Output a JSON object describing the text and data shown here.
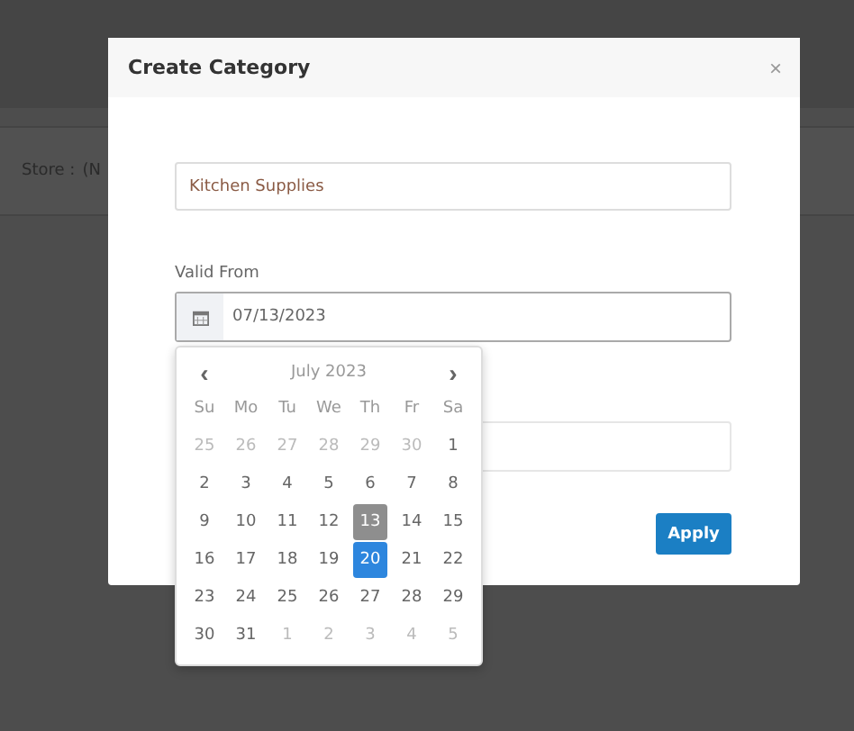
{
  "page": {
    "store_label": "Store :",
    "store_value": "(N"
  },
  "dialog": {
    "title": "Create Category",
    "close": "×",
    "name_value": "Kitchen Supplies",
    "valid_from_label": "Valid From",
    "valid_from_value": "07/13/2023",
    "apply": "Apply"
  },
  "datepicker": {
    "month": "July 2023",
    "prev": "‹",
    "next": "›",
    "weekdays": [
      "Su",
      "Mo",
      "Tu",
      "We",
      "Th",
      "Fr",
      "Sa"
    ],
    "weeks": [
      [
        {
          "day": "25",
          "other_month": true,
          "selected": false,
          "today": false
        },
        {
          "day": "26",
          "other_month": true,
          "selected": false,
          "today": false
        },
        {
          "day": "27",
          "other_month": true,
          "selected": false,
          "today": false
        },
        {
          "day": "28",
          "other_month": true,
          "selected": false,
          "today": false
        },
        {
          "day": "29",
          "other_month": true,
          "selected": false,
          "today": false
        },
        {
          "day": "30",
          "other_month": true,
          "selected": false,
          "today": false
        },
        {
          "day": "1",
          "other_month": false,
          "selected": false,
          "today": false
        }
      ],
      [
        {
          "day": "2",
          "other_month": false,
          "selected": false,
          "today": false
        },
        {
          "day": "3",
          "other_month": false,
          "selected": false,
          "today": false
        },
        {
          "day": "4",
          "other_month": false,
          "selected": false,
          "today": false
        },
        {
          "day": "5",
          "other_month": false,
          "selected": false,
          "today": false
        },
        {
          "day": "6",
          "other_month": false,
          "selected": false,
          "today": false
        },
        {
          "day": "7",
          "other_month": false,
          "selected": false,
          "today": false
        },
        {
          "day": "8",
          "other_month": false,
          "selected": false,
          "today": false
        }
      ],
      [
        {
          "day": "9",
          "other_month": false,
          "selected": false,
          "today": false
        },
        {
          "day": "10",
          "other_month": false,
          "selected": false,
          "today": false
        },
        {
          "day": "11",
          "other_month": false,
          "selected": false,
          "today": false
        },
        {
          "day": "12",
          "other_month": false,
          "selected": false,
          "today": false
        },
        {
          "day": "13",
          "other_month": false,
          "selected": true,
          "today": false
        },
        {
          "day": "14",
          "other_month": false,
          "selected": false,
          "today": false
        },
        {
          "day": "15",
          "other_month": false,
          "selected": false,
          "today": false
        }
      ],
      [
        {
          "day": "16",
          "other_month": false,
          "selected": false,
          "today": false
        },
        {
          "day": "17",
          "other_month": false,
          "selected": false,
          "today": false
        },
        {
          "day": "18",
          "other_month": false,
          "selected": false,
          "today": false
        },
        {
          "day": "19",
          "other_month": false,
          "selected": false,
          "today": false
        },
        {
          "day": "20",
          "other_month": false,
          "selected": false,
          "today": true
        },
        {
          "day": "21",
          "other_month": false,
          "selected": false,
          "today": false
        },
        {
          "day": "22",
          "other_month": false,
          "selected": false,
          "today": false
        }
      ],
      [
        {
          "day": "23",
          "other_month": false,
          "selected": false,
          "today": false
        },
        {
          "day": "24",
          "other_month": false,
          "selected": false,
          "today": false
        },
        {
          "day": "25",
          "other_month": false,
          "selected": false,
          "today": false
        },
        {
          "day": "26",
          "other_month": false,
          "selected": false,
          "today": false
        },
        {
          "day": "27",
          "other_month": false,
          "selected": false,
          "today": false
        },
        {
          "day": "28",
          "other_month": false,
          "selected": false,
          "today": false
        },
        {
          "day": "29",
          "other_month": false,
          "selected": false,
          "today": false
        }
      ],
      [
        {
          "day": "30",
          "other_month": false,
          "selected": false,
          "today": false
        },
        {
          "day": "31",
          "other_month": false,
          "selected": false,
          "today": false
        },
        {
          "day": "1",
          "other_month": true,
          "selected": false,
          "today": false
        },
        {
          "day": "2",
          "other_month": true,
          "selected": false,
          "today": false
        },
        {
          "day": "3",
          "other_month": true,
          "selected": false,
          "today": false
        },
        {
          "day": "4",
          "other_month": true,
          "selected": false,
          "today": false
        },
        {
          "day": "5",
          "other_month": true,
          "selected": false,
          "today": false
        }
      ]
    ]
  }
}
